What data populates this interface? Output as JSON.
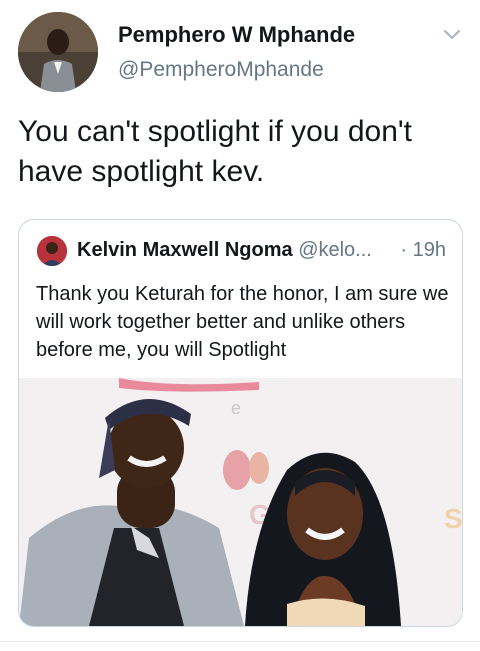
{
  "tweet": {
    "author_name": "Pemphero W Mphande",
    "author_handle": "@PempheroMphande",
    "text": "You can't spotlight if you don't have spotlight kev.",
    "avatar_icon": "user-avatar-photo",
    "menu_icon": "chevron-down-icon"
  },
  "quoted": {
    "author_name": "Kelvin Maxwell Ngoma",
    "author_handle": "@kelo...",
    "separator": "·",
    "time": "19h",
    "text": "Thank you Keturah for the honor,  I am sure we will work together better and unlike others before me,  you will Spotlight",
    "avatar_icon": "user-avatar-photo",
    "photo": "event-photo"
  },
  "colors": {
    "text_primary": "#14171a",
    "text_secondary": "#657786",
    "border": "#ccd6dd"
  }
}
